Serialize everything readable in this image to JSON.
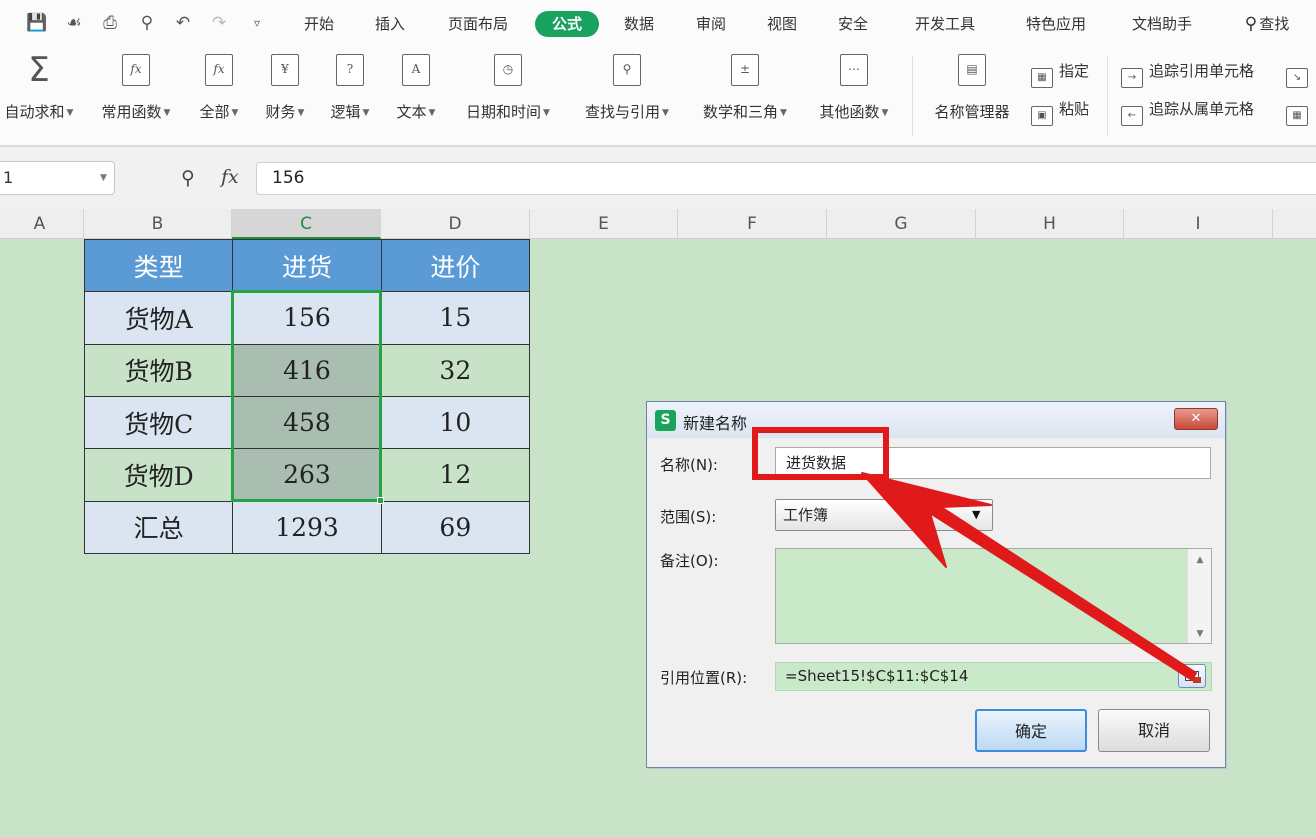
{
  "menubar": {
    "tabs": [
      "开始",
      "插入",
      "页面布局",
      "公式",
      "数据",
      "审阅",
      "视图",
      "安全",
      "开发工具",
      "特色应用",
      "文档助手"
    ],
    "active_tab": "公式",
    "search_label": "查找"
  },
  "ribbon": {
    "autosum": "自动求和",
    "common_funcs": "常用函数",
    "all_funcs": "全部",
    "finance": "财务",
    "logic": "逻辑",
    "text": "文本",
    "datetime": "日期和时间",
    "lookup": "查找与引用",
    "math": "数学和三角",
    "other": "其他函数",
    "name_manager": "名称管理器",
    "specify": "指定",
    "paste": "粘贴",
    "trace_precedents": "追踪引用单元格",
    "trace_dependents": "追踪从属单元格"
  },
  "formula_bar": {
    "name_box": "1",
    "fx": "fx",
    "value": "156"
  },
  "columns": [
    "A",
    "B",
    "C",
    "D",
    "E",
    "F",
    "G",
    "H",
    "I"
  ],
  "table": {
    "headers": [
      "类型",
      "进货",
      "进价"
    ],
    "rows": [
      [
        "货物A",
        "156",
        "15"
      ],
      [
        "货物B",
        "416",
        "32"
      ],
      [
        "货物C",
        "458",
        "10"
      ],
      [
        "货物D",
        "263",
        "12"
      ],
      [
        "汇总",
        "1293",
        "69"
      ]
    ]
  },
  "dialog": {
    "title": "新建名称",
    "logo": "S",
    "name_label": "名称(N):",
    "name_value": "进货数据",
    "scope_label": "范围(S):",
    "scope_value": "工作簿",
    "comment_label": "备注(O):",
    "ref_label": "引用位置(R):",
    "ref_value": "=Sheet15!$C$11:$C$14",
    "ok": "确定",
    "cancel": "取消"
  },
  "annotation_color": "#e01a1a",
  "accent_color": "#19a15f"
}
